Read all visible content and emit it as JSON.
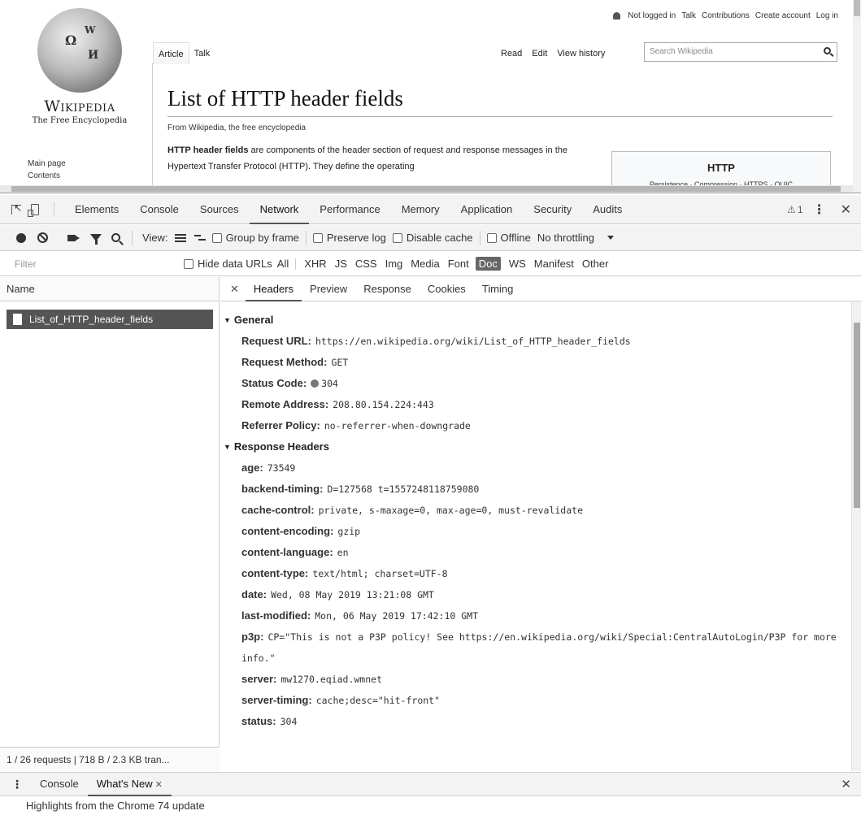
{
  "wiki": {
    "personal": [
      "Not logged in",
      "Talk",
      "Contributions",
      "Create account",
      "Log in"
    ],
    "logo_wordmark": "Wikipedia",
    "logo_tagline": "The Free Encyclopedia",
    "sidenav": [
      "Main page",
      "Contents"
    ],
    "tabs_left": [
      "Article",
      "Talk"
    ],
    "tabs_right": [
      "Read",
      "Edit",
      "View history"
    ],
    "search_placeholder": "Search Wikipedia",
    "title": "List of HTTP header fields",
    "from": "From Wikipedia, the free encyclopedia",
    "lead_bold": "HTTP header fields",
    "lead_rest": " are components of the header section of request and response messages in the Hypertext Transfer Protocol (HTTP). They define the operating",
    "infobox_title": "HTTP",
    "infobox_links": "Persistence · Compression · HTTPS · QUIC"
  },
  "devtools": {
    "tabs": [
      "Elements",
      "Console",
      "Sources",
      "Network",
      "Performance",
      "Memory",
      "Application",
      "Security",
      "Audits"
    ],
    "active_tab": "Network",
    "warning_count": "1",
    "toolbar": {
      "view_label": "View:",
      "group_by_frame": "Group by frame",
      "preserve_log": "Preserve log",
      "disable_cache": "Disable cache",
      "offline": "Offline",
      "throttling": "No throttling"
    },
    "filter": {
      "placeholder": "Filter",
      "hide_data_urls": "Hide data URLs",
      "types": [
        "All",
        "XHR",
        "JS",
        "CSS",
        "Img",
        "Media",
        "Font",
        "Doc",
        "WS",
        "Manifest",
        "Other"
      ],
      "active_type": "Doc"
    },
    "name_column": "Name",
    "request_name": "List_of_HTTP_header_fields",
    "summary": "1 / 26 requests | 718 B / 2.3 KB tran...",
    "detail_tabs": [
      "Headers",
      "Preview",
      "Response",
      "Cookies",
      "Timing"
    ],
    "active_detail_tab": "Headers",
    "general_title": "General",
    "general": [
      {
        "k": "Request URL:",
        "v": "https://en.wikipedia.org/wiki/List_of_HTTP_header_fields"
      },
      {
        "k": "Request Method:",
        "v": "GET"
      },
      {
        "k": "Status Code:",
        "v": "304"
      },
      {
        "k": "Remote Address:",
        "v": "208.80.154.224:443"
      },
      {
        "k": "Referrer Policy:",
        "v": "no-referrer-when-downgrade"
      }
    ],
    "response_title": "Response Headers",
    "response": [
      {
        "k": "age:",
        "v": "73549"
      },
      {
        "k": "backend-timing:",
        "v": "D=127568 t=1557248118759080"
      },
      {
        "k": "cache-control:",
        "v": "private, s-maxage=0, max-age=0, must-revalidate"
      },
      {
        "k": "content-encoding:",
        "v": "gzip"
      },
      {
        "k": "content-language:",
        "v": "en"
      },
      {
        "k": "content-type:",
        "v": "text/html; charset=UTF-8"
      },
      {
        "k": "date:",
        "v": "Wed, 08 May 2019 13:21:08 GMT"
      },
      {
        "k": "last-modified:",
        "v": "Mon, 06 May 2019 17:42:10 GMT"
      },
      {
        "k": "p3p:",
        "v": "CP=\"This is not a P3P policy! See https://en.wikipedia.org/wiki/Special:CentralAutoLogin/P3P for more info.\""
      },
      {
        "k": "server:",
        "v": "mw1270.eqiad.wmnet"
      },
      {
        "k": "server-timing:",
        "v": "cache;desc=\"hit-front\""
      },
      {
        "k": "status:",
        "v": "304"
      }
    ],
    "drawer_tabs": [
      "Console",
      "What's New"
    ],
    "drawer_active": "What's New",
    "drawer_text": "Highlights from the Chrome 74 update"
  }
}
